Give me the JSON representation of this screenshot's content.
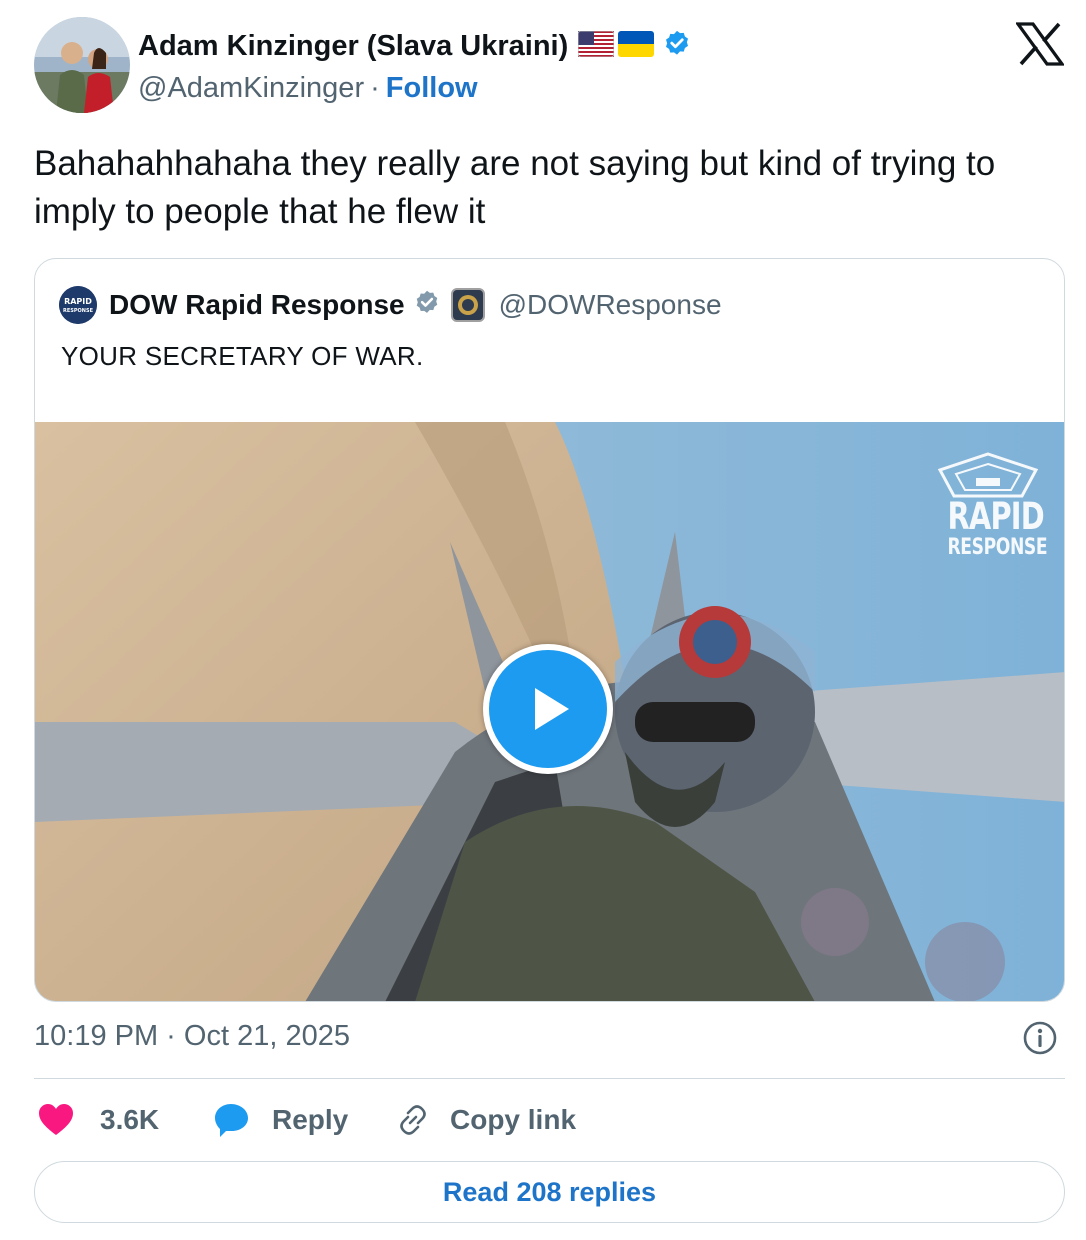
{
  "author": {
    "display_name": "Adam Kinzinger (Slava Ukraini)",
    "handle": "@AdamKinzinger",
    "separator": "·",
    "follow_label": "Follow",
    "flags": [
      "us-flag-icon",
      "ukraine-flag-icon"
    ],
    "verified": true
  },
  "tweet": {
    "text": "Bahahahhahaha they really are not saying but kind of trying to imply to people that he flew it",
    "timestamp": "10:19 PM · Oct 21, 2025"
  },
  "quoted": {
    "display_name": "DOW Rapid Response",
    "handle": "@DOWResponse",
    "text": "YOUR SECRETARY OF WAR.",
    "avatar_text": "RAPID RESPONSE",
    "media": {
      "type": "video",
      "watermark_title": "RAPID",
      "watermark_subtitle": "RESPONSE"
    }
  },
  "actions": {
    "likes": "3.6K",
    "reply_label": "Reply",
    "copy_label": "Copy link",
    "read_replies_label": "Read 208 replies"
  },
  "colors": {
    "link": "#1d74c8",
    "verified": "#1d9bf0",
    "like": "#f91880",
    "muted": "#536471",
    "border": "#cfd9de"
  }
}
